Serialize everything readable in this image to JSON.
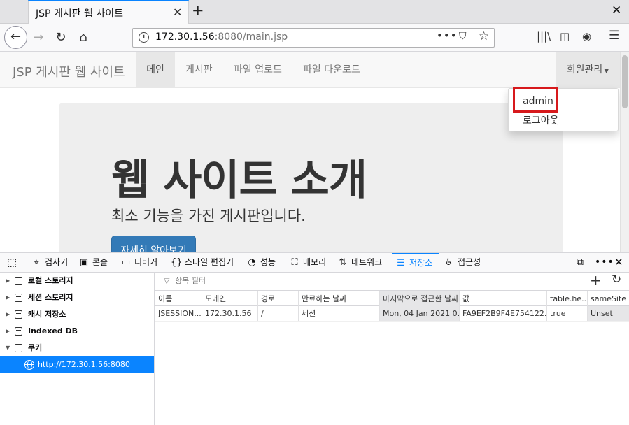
{
  "browser": {
    "tab_title": "JSP 게시판 웹 사이트",
    "url_host": "172.30.1.56",
    "url_rest": ":8080/main.jsp"
  },
  "site": {
    "brand": "JSP 게시판 웹 사이트",
    "nav": [
      "메인",
      "게시판",
      "파일 업로드",
      "파일 다운로드"
    ],
    "member_menu": "회원관리",
    "dropdown": [
      "admin",
      "로그아웃"
    ],
    "jumbotron": {
      "title": "웹 사이트 소개",
      "subtitle": "최소 기능을 가진 게시판입니다.",
      "button": "자세히 알아보기"
    }
  },
  "devtools": {
    "tabs": [
      "검사기",
      "콘솔",
      "디버거",
      "스타일 편집기",
      "성능",
      "메모리",
      "네트워크",
      "저장소",
      "접근성"
    ],
    "active_tab": "저장소",
    "tree": [
      "로컬 스토리지",
      "세션 스토리지",
      "캐시 저장소",
      "Indexed DB",
      "쿠키"
    ],
    "tree_host": "http://172.30.1.56:8080",
    "filter_placeholder": "항목 필터",
    "columns": [
      "이름",
      "도메인",
      "경로",
      "만료하는 날짜",
      "마지막으로 접근한 날짜",
      "값",
      "table.he...",
      "sameSite"
    ],
    "row": [
      "JSESSION...",
      "172.30.1.56",
      "/",
      "세션",
      "Mon, 04 Jan 2021 0...",
      "FA9EF2B9F4E754122...",
      "true",
      "Unset"
    ]
  }
}
